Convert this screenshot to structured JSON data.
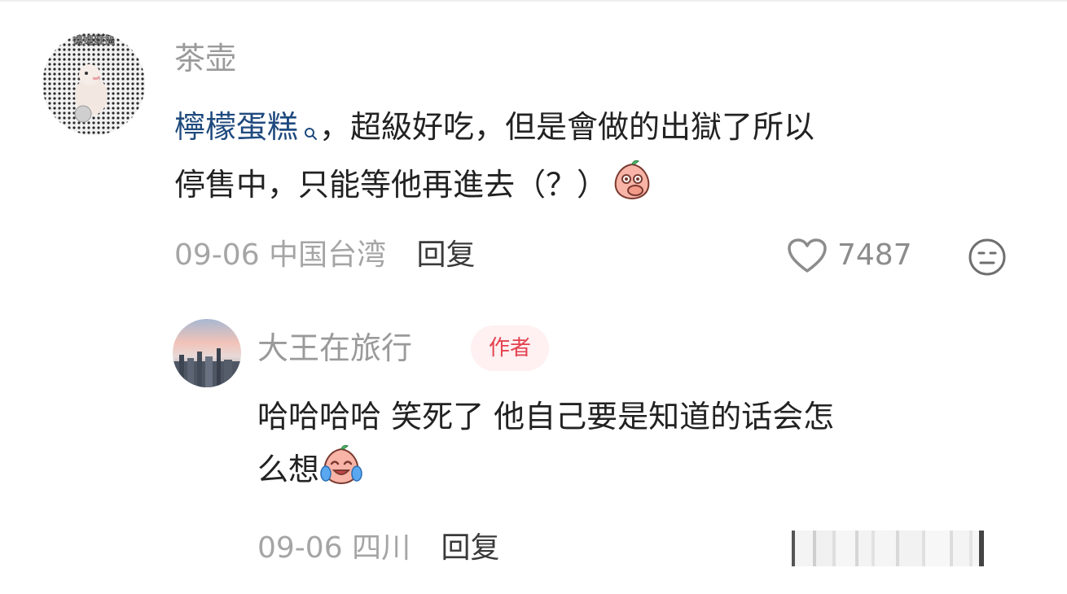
{
  "comment": {
    "username": "茶壶",
    "link_text": "檸檬蛋糕",
    "text_after_link_line1": "，超級好吃，但是會做的出獄了所以",
    "text_line2": "停售中，只能等他再進去（？）",
    "date": "09-06",
    "location": "中国台湾",
    "reply_label": "回复",
    "like_count": "7487",
    "avatar_watermark": "媽媽雜摳",
    "emoji": "covering-mouth-peach-emoji"
  },
  "reply": {
    "username": "大王在旅行",
    "author_badge": "作者",
    "text_line1": "哈哈哈哈 笑死了 他自己要是知道的话会怎",
    "text_line2": "么想",
    "date": "09-06",
    "location": "四川",
    "reply_label": "回复",
    "emoji": "crying-laughing-peach-emoji"
  },
  "icons": {
    "search": "search-icon",
    "like": "heart-outline-icon",
    "dislike": "neutral-face-icon"
  },
  "colors": {
    "link": "#1f4a7e",
    "badge_bg": "#fff0f1",
    "badge_text": "#e3414f",
    "muted": "#a5a5a5"
  }
}
